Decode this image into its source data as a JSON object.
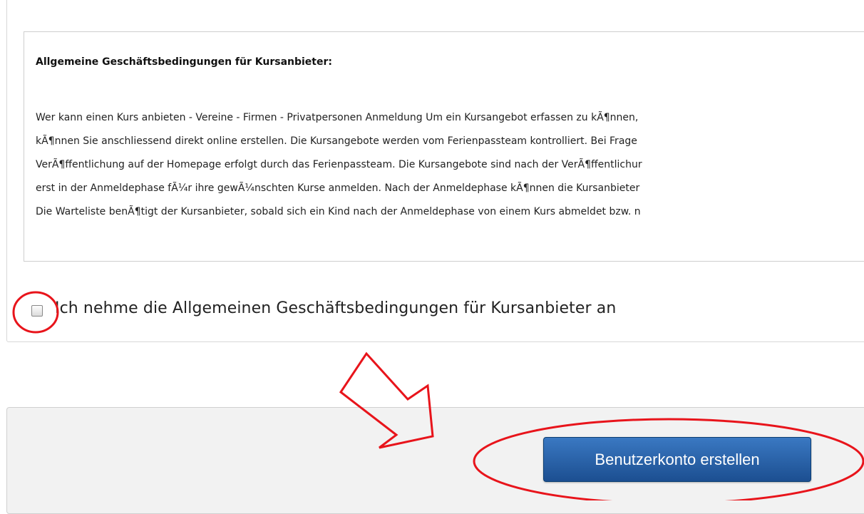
{
  "terms": {
    "title": "Allgemeine Geschäftsbedingungen für Kursanbieter:",
    "lines": [
      "Wer kann einen Kurs anbieten - Vereine - Firmen - Privatpersonen Anmeldung Um ein Kursangebot erfassen zu kÃ¶nnen,",
      "kÃ¶nnen Sie anschliessend direkt online erstellen. Die Kursangebote werden vom Ferienpassteam kontrolliert. Bei Frage",
      "VerÃ¶ffentlichung auf der Homepage erfolgt durch das Ferienpassteam. Die Kursangebote sind nach der VerÃ¶ffentlichur",
      "erst in der Anmeldephase fÃ¼r ihre gewÃ¼nschten Kurse anmelden. Nach der Anmeldephase kÃ¶nnen die Kursanbieter",
      "Die Warteliste benÃ¶tigt der Kursanbieter, sobald sich ein Kind nach der Anmeldephase von einem Kurs abmeldet bzw. n"
    ]
  },
  "agree": {
    "label": "Ich nehme die Allgemeinen Geschäftsbedingungen für Kursanbieter an"
  },
  "submit": {
    "label": "Benutzerkonto erstellen"
  },
  "colors": {
    "annotation": "#e8141b",
    "button": "#1c4f91"
  }
}
